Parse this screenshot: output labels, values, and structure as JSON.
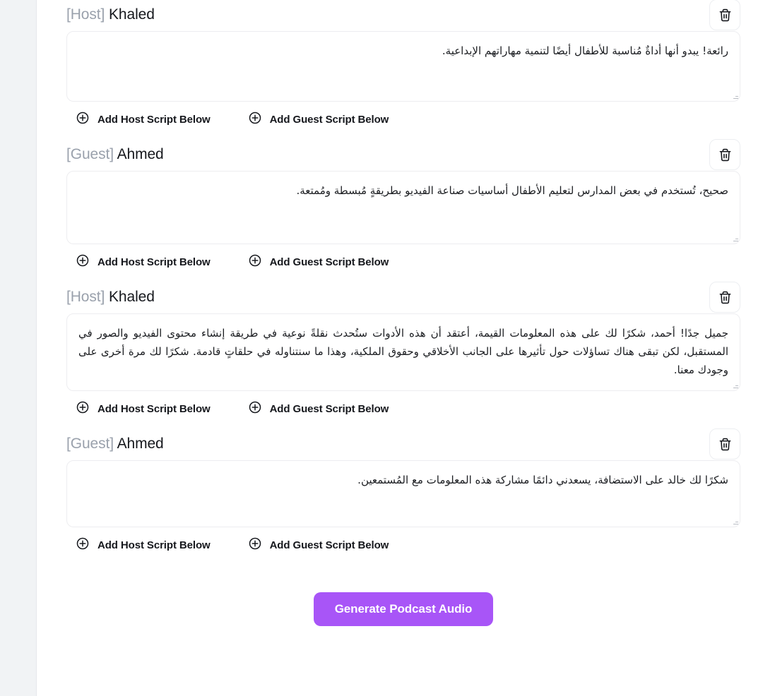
{
  "theme": {
    "accent": "#a855f7",
    "sidebar_bg": "#f1f3f5",
    "page_bg": "#ffffff",
    "text": "#16181d",
    "muted_text": "#9aa1ac",
    "border": "#ededf0"
  },
  "icons": {
    "delete": "trash-icon",
    "add": "plus-circle-icon",
    "resize": "resize-grip-icon"
  },
  "actions": {
    "add_host_label": "Add Host Script Below",
    "add_guest_label": "Add Guest Script Below",
    "delete_title": "Delete"
  },
  "footer": {
    "generate_label": "Generate Podcast Audio"
  },
  "blocks": [
    {
      "role": "[Host]",
      "name": "Khaled",
      "script": "رائعة! يبدو أنها أداةٌ مُناسبة للأطفال أيضًا لتنمية مهاراتهم الإبداعية."
    },
    {
      "role": "[Guest]",
      "name": "Ahmed",
      "script": "صحيح، تُستخدم في بعض المدارس لتعليم الأطفال أساسيات صناعة الفيديو بطريقةٍ مُبسطة ومُمتعة."
    },
    {
      "role": "[Host]",
      "name": "Khaled",
      "script": "جميل جدًا! أحمد، شكرًا لك على هذه المعلومات القيمة، أعتقد أن هذه الأدوات ستُحدث نقلةً نوعية في طريقة إنشاء محتوى الفيديو والصور في المستقبل، لكن تبقى هناك تساؤلات حول تأثيرها على الجانب الأخلاقي وحقوق الملكية، وهذا ما سنتناوله في حلقاتٍ قادمة. شكرًا لك مرة أخرى على وجودك معنا."
    },
    {
      "role": "[Guest]",
      "name": "Ahmed",
      "script": "شكرًا لك خالد على الاستضافة، يسعدني دائمًا مشاركة هذه المعلومات مع المُستمعين."
    }
  ]
}
